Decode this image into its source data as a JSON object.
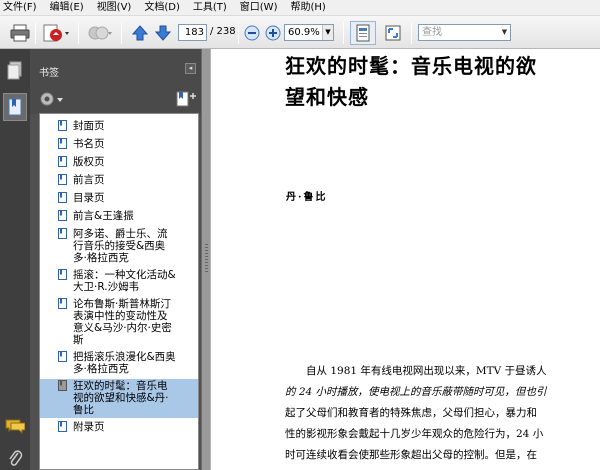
{
  "menu": [
    "文件(F)",
    "编辑(E)",
    "视图(V)",
    "文档(D)",
    "工具(T)",
    "窗口(W)",
    "帮助(H)"
  ],
  "toolbar": {
    "page_current": "183",
    "page_total": "/ 238",
    "zoom": "60.9%",
    "search_placeholder": "查找"
  },
  "panel": {
    "title": "书签"
  },
  "bookmarks": [
    {
      "label_lines": [
        "封面页"
      ]
    },
    {
      "label_lines": [
        "书名页"
      ]
    },
    {
      "label_lines": [
        "版权页"
      ]
    },
    {
      "label_lines": [
        "前言页"
      ]
    },
    {
      "label_lines": [
        "目录页"
      ]
    },
    {
      "label_lines": [
        "前言&王逢振"
      ]
    },
    {
      "label_lines": [
        "阿多诺、爵士乐、流",
        "行音乐的接受&西奥",
        "多·格拉西克"
      ]
    },
    {
      "label_lines": [
        "摇滚：一种文化活动&",
        "大卫·R.沙姆韦"
      ]
    },
    {
      "label_lines": [
        "论布鲁斯·斯普林斯汀",
        "表演中性的变动性及",
        "意义&马沙·内尔·史密",
        "斯"
      ]
    },
    {
      "label_lines": [
        "把摇滚乐浪漫化&西奥",
        "多·格拉西克"
      ]
    },
    {
      "label_lines": [
        "狂欢的时髦：音乐电",
        "视的欲望和快感&丹·",
        "鲁比"
      ],
      "selected": true
    },
    {
      "label_lines": [
        "附录页"
      ]
    }
  ],
  "document": {
    "title_lines": [
      "狂欢的时髦：音乐电视的欲",
      "望和快感"
    ],
    "author": "丹·鲁比",
    "body_lines": [
      "　　自从 1981 年有线电视网出现以来，MTV 于昼诱人",
      "的 24 小时播放，使电视上的音乐蔽带随时可见，但也引",
      "起了父母们和教育者的特殊焦虑，父母们担心，暴力和",
      "性的影视形象会戴起十几岁少年观众的危险行为，24 小",
      "时可连续收看会使那些形象超出父母的控制。但是，在"
    ]
  },
  "colors": {
    "selected_bookmark": "#a9c8e8",
    "panel_bg": "#505050",
    "rail_bg": "#3e3e3e"
  }
}
